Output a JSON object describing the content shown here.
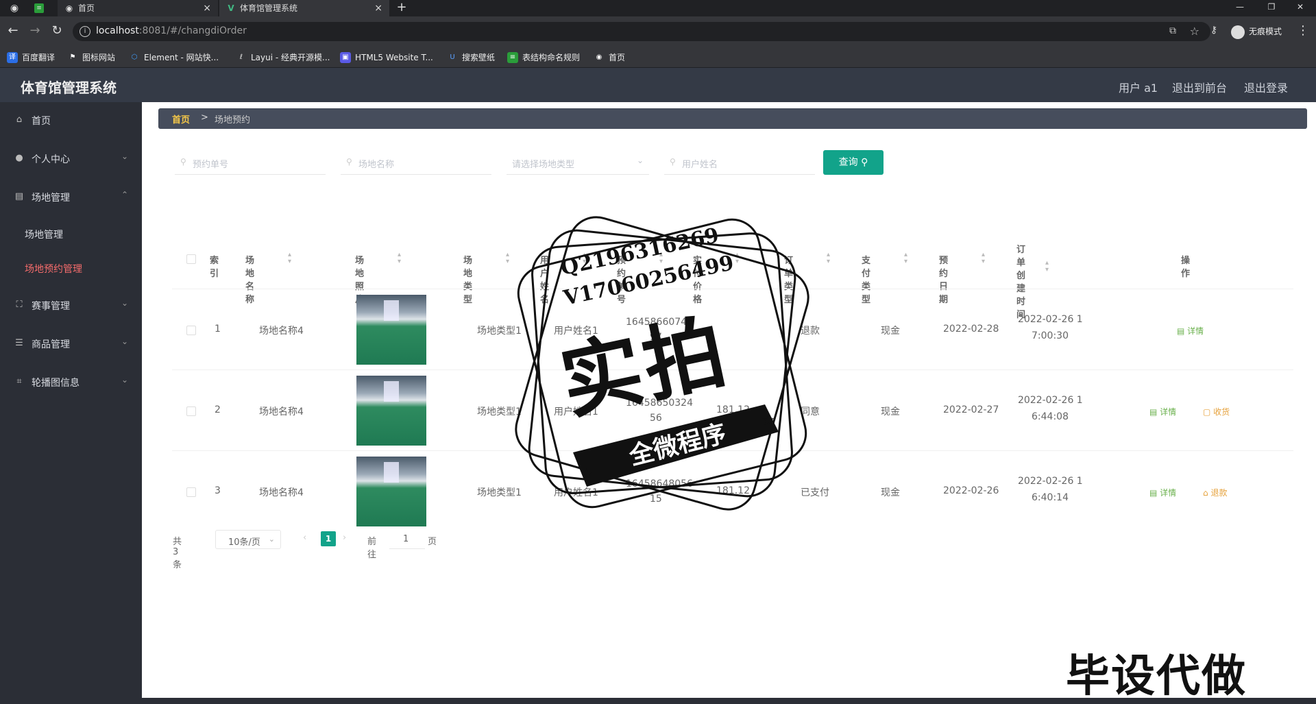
{
  "browser": {
    "tabs": [
      {
        "label": "首页",
        "icon": "globe-icon"
      },
      {
        "label": "体育馆管理系统",
        "icon": "vue-logo-icon"
      }
    ],
    "url_host": "localhost",
    "url_path": ":8081/#/changdiOrder",
    "profile_label": "无痕模式",
    "bookmarks": [
      "百度翻译",
      "图标网站",
      "Element - 网站快...",
      "Layui - 经典开源模...",
      "HTML5 Website T...",
      "搜索壁纸",
      "表结构命名规则",
      "首页"
    ]
  },
  "header": {
    "title": "体育馆管理系统",
    "user": "用户 a1",
    "to_front": "退出到前台",
    "logout": "退出登录"
  },
  "sidebar": {
    "items": [
      {
        "label": "首页",
        "icon": "home-icon"
      },
      {
        "label": "个人中心",
        "icon": "user-icon"
      },
      {
        "label": "场地管理",
        "icon": "document-icon"
      },
      {
        "label": "赛事管理",
        "icon": "expand-icon"
      },
      {
        "label": "商品管理",
        "icon": "list-icon"
      },
      {
        "label": "轮播图信息",
        "icon": "crop-icon"
      }
    ],
    "sub_items": [
      {
        "label": "场地管理"
      },
      {
        "label": "场地预约管理"
      }
    ]
  },
  "breadcrumb": {
    "home": "首页",
    "separator": ">",
    "current": "场地预约"
  },
  "filters": {
    "order_no_placeholder": "预约单号",
    "venue_name_placeholder": "场地名称",
    "venue_type_placeholder": "请选择场地类型",
    "user_name_placeholder": "用户姓名",
    "search_label": "查询"
  },
  "table": {
    "headers": {
      "index": "索引",
      "venue_name": "场地名称",
      "venue_photo": "场地照片",
      "venue_type": "场地类型",
      "user_name": "用户姓名",
      "order_no": "预约单号",
      "paid_price": "实付价格",
      "order_type": "订单类型",
      "pay_type": "支付类型",
      "book_date": "预约日期",
      "created_at": "订单创建时间",
      "actions": "操作"
    },
    "rows": [
      {
        "index": "1",
        "venue_name": "场地名称4",
        "venue_type": "场地类型1",
        "user_name": "用户姓名1",
        "order_no_a": "16458660741",
        "order_no_b": "97",
        "price": "",
        "order_type": "退款",
        "pay_type": "现金",
        "book_date": "2022-02-28",
        "created_a": "2022-02-26 1",
        "created_b": "7:00:30",
        "actions": [
          "详情"
        ]
      },
      {
        "index": "2",
        "venue_name": "场地名称4",
        "venue_type": "场地类型1",
        "user_name": "用户姓名1",
        "order_no_a": "16458650324",
        "order_no_b": "56",
        "price": "181.12",
        "order_type": "同意",
        "pay_type": "现金",
        "book_date": "2022-02-27",
        "created_a": "2022-02-26 1",
        "created_b": "6:44:08",
        "actions": [
          "详情",
          "收货"
        ]
      },
      {
        "index": "3",
        "venue_name": "场地名称4",
        "venue_type": "场地类型1",
        "user_name": "用户姓名1",
        "order_no_a": "16458648056",
        "order_no_b": "15",
        "price": "181.12",
        "order_type": "已支付",
        "pay_type": "现金",
        "book_date": "2022-02-26",
        "created_a": "2022-02-26 1",
        "created_b": "6:40:14",
        "actions": [
          "详情",
          "退款"
        ]
      }
    ]
  },
  "pagination": {
    "total": "共 3 条",
    "page_size": "10条/页",
    "current_page": "1",
    "goto_label": "前往",
    "goto_value": "1",
    "page_unit": "页"
  },
  "watermark": {
    "line1": "Q2196316269",
    "line2": "V17060256499",
    "big": "实拍",
    "ribbon": "全微程序",
    "corner": "毕设代做"
  },
  "colors": {
    "accent": "#12a38a",
    "active_menu": "#f56c6c",
    "crumb_home": "#f7c948",
    "detail": "#6ab04c",
    "warn": "#e6a23c"
  }
}
